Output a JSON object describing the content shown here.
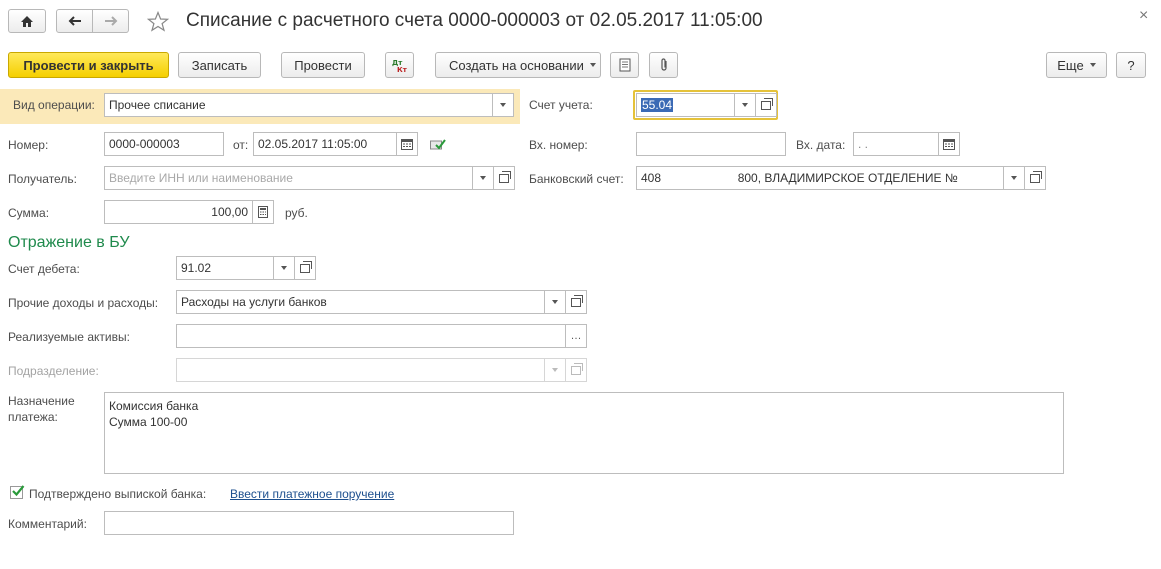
{
  "header": {
    "title": "Списание с расчетного счета 0000-000003 от 02.05.2017 11:05:00",
    "close_glyph": "×"
  },
  "toolbar": {
    "post_and_close": "Провести и закрыть",
    "save": "Записать",
    "post": "Провести",
    "create_based_on": "Создать на основании",
    "more": "Еще",
    "help": "?"
  },
  "form": {
    "operation_type": {
      "label": "Вид операции:",
      "value": "Прочее списание"
    },
    "account": {
      "label": "Счет учета:",
      "value": "55.04"
    },
    "number": {
      "label": "Номер:",
      "value": "0000-000003"
    },
    "date": {
      "label": "от:",
      "value": "02.05.2017 11:05:00"
    },
    "incoming_number": {
      "label": "Вх. номер:",
      "value": ""
    },
    "incoming_date": {
      "label": "Вх. дата:",
      "value": " .  ."
    },
    "recipient": {
      "label": "Получатель:",
      "placeholder": "Введите ИНН или наименование"
    },
    "bank_account": {
      "label": "Банковский счет:",
      "value": "408                       800, ВЛАДИМИРСКОЕ ОТДЕЛЕНИЕ №"
    },
    "amount": {
      "label": "Сумма:",
      "value": "100,00",
      "currency": "руб."
    }
  },
  "accounting": {
    "section_title": "Отражение в БУ",
    "debit_account": {
      "label": "Счет дебета:",
      "value": "91.02"
    },
    "other_income_expenses": {
      "label": "Прочие доходы и расходы:",
      "value": "Расходы на услуги банков"
    },
    "realized_assets": {
      "label": "Реализуемые активы:",
      "value": ""
    },
    "department": {
      "label": "Подразделение:",
      "value": ""
    }
  },
  "purpose": {
    "label_line1": "Назначение",
    "label_line2": "платежа:",
    "line1": "Комиссия банка",
    "line2": "Сумма 100-00"
  },
  "confirm": {
    "label": "Подтверждено выпиской банка:",
    "checked": true,
    "link": "Ввести платежное поручение"
  },
  "comment": {
    "label": "Комментарий:",
    "value": ""
  },
  "colors": {
    "primary_button": "#f5cf00",
    "section_title": "#1f8a4c",
    "highlight_row": "#fbe9b9",
    "focus_border": "#e5c23a",
    "link": "#1d4f8e"
  }
}
